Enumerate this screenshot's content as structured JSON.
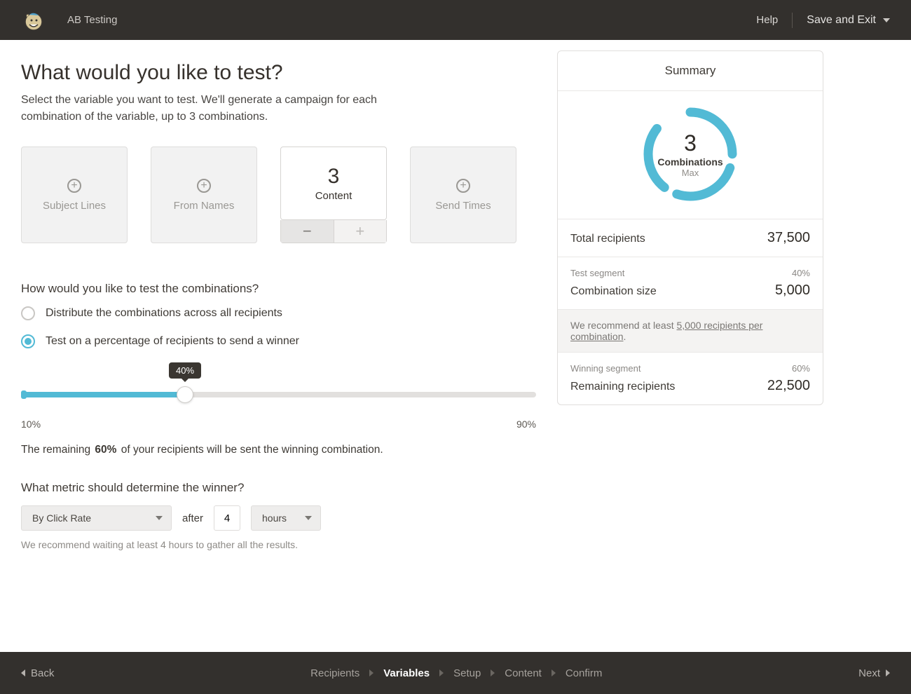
{
  "topbar": {
    "title": "AB Testing",
    "help": "Help",
    "save_exit": "Save and Exit"
  },
  "page": {
    "heading": "What would you like to test?",
    "subheading": "Select the variable you want to test. We'll generate a campaign for each combination of the variable, up to 3 combinations."
  },
  "variables": {
    "subject_lines": "Subject Lines",
    "from_names": "From Names",
    "content_label": "Content",
    "content_count": "3",
    "send_times": "Send Times"
  },
  "combo_question": "How would you like to test the combinations?",
  "radio1": "Distribute the combinations across all recipients",
  "radio2": "Test on a percentage of recipients to send a winner",
  "slider": {
    "tooltip": "40%",
    "min_label": "10%",
    "max_label": "90%"
  },
  "remaining": {
    "prefix": "The remaining ",
    "pct": "60%",
    "suffix": " of your recipients will be sent the winning combination."
  },
  "metric": {
    "question": "What metric should determine the winner?",
    "select_metric": "By Click Rate",
    "after_label": "after",
    "hours_value": "4",
    "unit_select": "hours",
    "hint": "We recommend waiting at least 4 hours to gather all the results."
  },
  "summary": {
    "title": "Summary",
    "donut_number": "3",
    "donut_label": "Combinations",
    "donut_sub": "Max",
    "total_recipients_label": "Total recipients",
    "total_recipients_value": "37,500",
    "test_segment_label": "Test segment",
    "test_segment_value": "40%",
    "combo_size_label": "Combination size",
    "combo_size_value": "5,000",
    "reco_prefix": "We recommend at least ",
    "reco_link": "5,000 recipients per combination",
    "reco_suffix": ".",
    "winning_segment_label": "Winning segment",
    "winning_segment_value": "60%",
    "remaining_recipients_label": "Remaining recipients",
    "remaining_recipients_value": "22,500"
  },
  "bottombar": {
    "back": "Back",
    "next": "Next",
    "steps": {
      "recipients": "Recipients",
      "variables": "Variables",
      "setup": "Setup",
      "content": "Content",
      "confirm": "Confirm"
    }
  }
}
